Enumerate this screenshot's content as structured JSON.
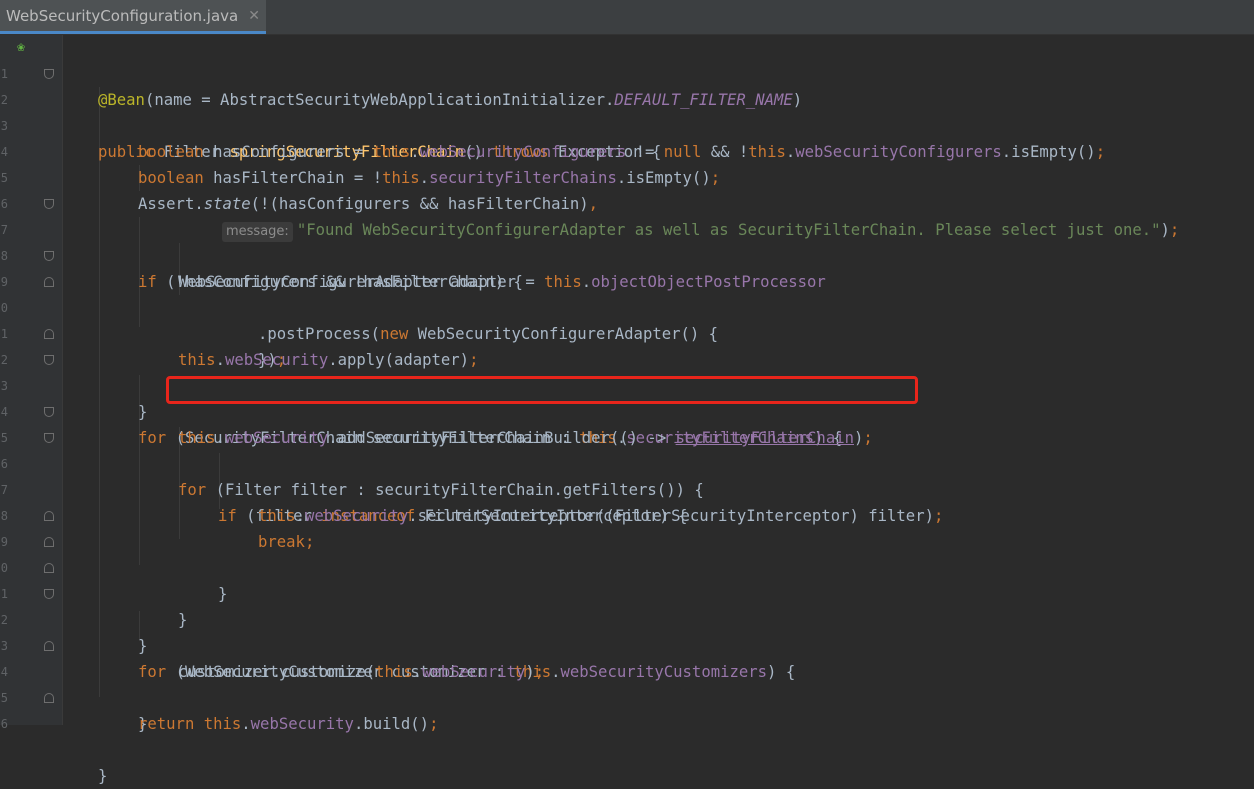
{
  "tab": {
    "title": "WebSecurityConfiguration.java",
    "close": "✕"
  },
  "gutter": {
    "bean_icon": "spring-bean-icon"
  },
  "hint": {
    "label": "message:"
  },
  "lines": {
    "l1": [
      "@Bean",
      "(name = AbstractSecurityWebApplicationInitializer.",
      "DEFAULT_FILTER_NAME",
      ")"
    ],
    "l2": [
      "public ",
      "Filter ",
      "springSecurityFilterChain",
      "() ",
      "throws ",
      "Exception {"
    ],
    "l3": [
      "boolean ",
      "hasConfigurers = ",
      "this",
      ".",
      "webSecurityConfigurers",
      " != ",
      "null",
      " && !",
      "this",
      ".",
      "webSecurityConfigurers",
      ".isEmpty()",
      ";"
    ],
    "l4": [
      "boolean ",
      "hasFilterChain = !",
      "this",
      ".",
      "securityFilterChains",
      ".isEmpty()",
      ";"
    ],
    "l5": [
      "Assert.",
      "state",
      "(!(hasConfigurers && hasFilterChain)",
      ","
    ],
    "l6": [
      "\"Found WebSecurityConfigurerAdapter as well as SecurityFilterChain. Please select just one.\"",
      ")",
      ";"
    ],
    "l7": [
      "if ",
      "(!hasConfigurers && !hasFilterChain) {"
    ],
    "l8": [
      "WebSecurityConfigurerAdapter adapter = ",
      "this",
      ".",
      "objectObjectPostProcessor"
    ],
    "l9": [
      ".postProcess(",
      "new ",
      "WebSecurityConfigurerAdapter() {"
    ],
    "l10": [
      "})",
      ";"
    ],
    "l11": [
      "this",
      ".",
      "webSecurity",
      ".apply(adapter)",
      ";"
    ],
    "l12": [
      "}"
    ],
    "l13": [
      "for ",
      "(SecurityFilterChain securityFilterChain : ",
      "this",
      ".",
      "securityFilterChains",
      ") {"
    ],
    "l14": [
      "this",
      ".",
      "webSecurity",
      ".addSecurityFilterChainBuilder(() -> ",
      "securityFilterChain",
      ")",
      ";"
    ],
    "l15": [
      "for ",
      "(Filter filter : securityFilterChain.getFilters()) {"
    ],
    "l16": [
      "if ",
      "(filter ",
      "instanceof ",
      "FilterSecurityInterceptor) {"
    ],
    "l17": [
      "this",
      ".",
      "webSecurity",
      ".securityInterceptor((FilterSecurityInterceptor) filter)",
      ";"
    ],
    "l18": [
      "break",
      ";"
    ],
    "l19": [
      "}"
    ],
    "l20": [
      "}"
    ],
    "l21": [
      "}"
    ],
    "l22": [
      "for ",
      "(WebSecurityCustomizer customizer : ",
      "this",
      ".",
      "webSecurityCustomizers",
      ") {"
    ],
    "l23": [
      "customizer.customize(",
      "this",
      ".",
      "webSecurity",
      ")",
      ";"
    ],
    "l24": [
      "}"
    ],
    "l25": [
      "return ",
      "this",
      ".",
      "webSecurity",
      ".build()",
      ";"
    ],
    "l26": [
      "}"
    ]
  },
  "line_numbers": [
    "1",
    "2",
    "3",
    "4",
    "5",
    "6",
    "7",
    "8",
    "9",
    "0",
    "1",
    "2",
    "3",
    "4",
    "5",
    "6",
    "7",
    "8",
    "9",
    "0",
    "1",
    "2",
    "3",
    "4",
    "5",
    "6"
  ],
  "colors": {
    "background": "#2b2b2b",
    "keyword": "#cc7832",
    "annotation": "#bbb529",
    "field": "#9876aa",
    "method_decl": "#ffc66d",
    "string": "#6a8759",
    "text": "#a9b7c6",
    "highlight_border": "#e8251b"
  }
}
